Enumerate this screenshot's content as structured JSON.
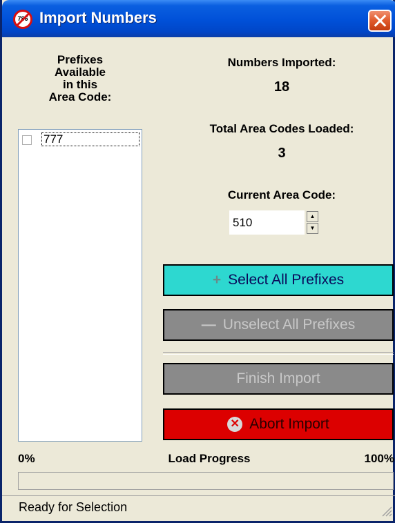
{
  "window": {
    "title": "Import Numbers",
    "icon_text": "786",
    "close_icon": "close-icon"
  },
  "prefixes": {
    "label": [
      "Prefixes",
      "Available",
      "in this",
      "Area Code:"
    ],
    "items": [
      {
        "label": "777",
        "checked": false
      }
    ]
  },
  "stats": {
    "numbers_imported_label": "Numbers Imported:",
    "numbers_imported_value": "18",
    "total_area_codes_label": "Total Area Codes Loaded:",
    "total_area_codes_value": "3",
    "current_area_code_label": "Current Area Code:",
    "current_area_code_value": "510"
  },
  "buttons": {
    "select_all": "Select All Prefixes",
    "unselect_all": "Unselect All Prefixes",
    "finish_import": "Finish Import",
    "abort_import": "Abort Import"
  },
  "progress": {
    "min_label": "0%",
    "title": "Load Progress",
    "max_label": "100%",
    "value": 0
  },
  "status": {
    "text": "Ready for Selection"
  },
  "colors": {
    "title_bar": "#0050d8",
    "select_button": "#2dd8d0",
    "disabled_button": "#8a8a8a",
    "abort_button": "#dc0000"
  }
}
